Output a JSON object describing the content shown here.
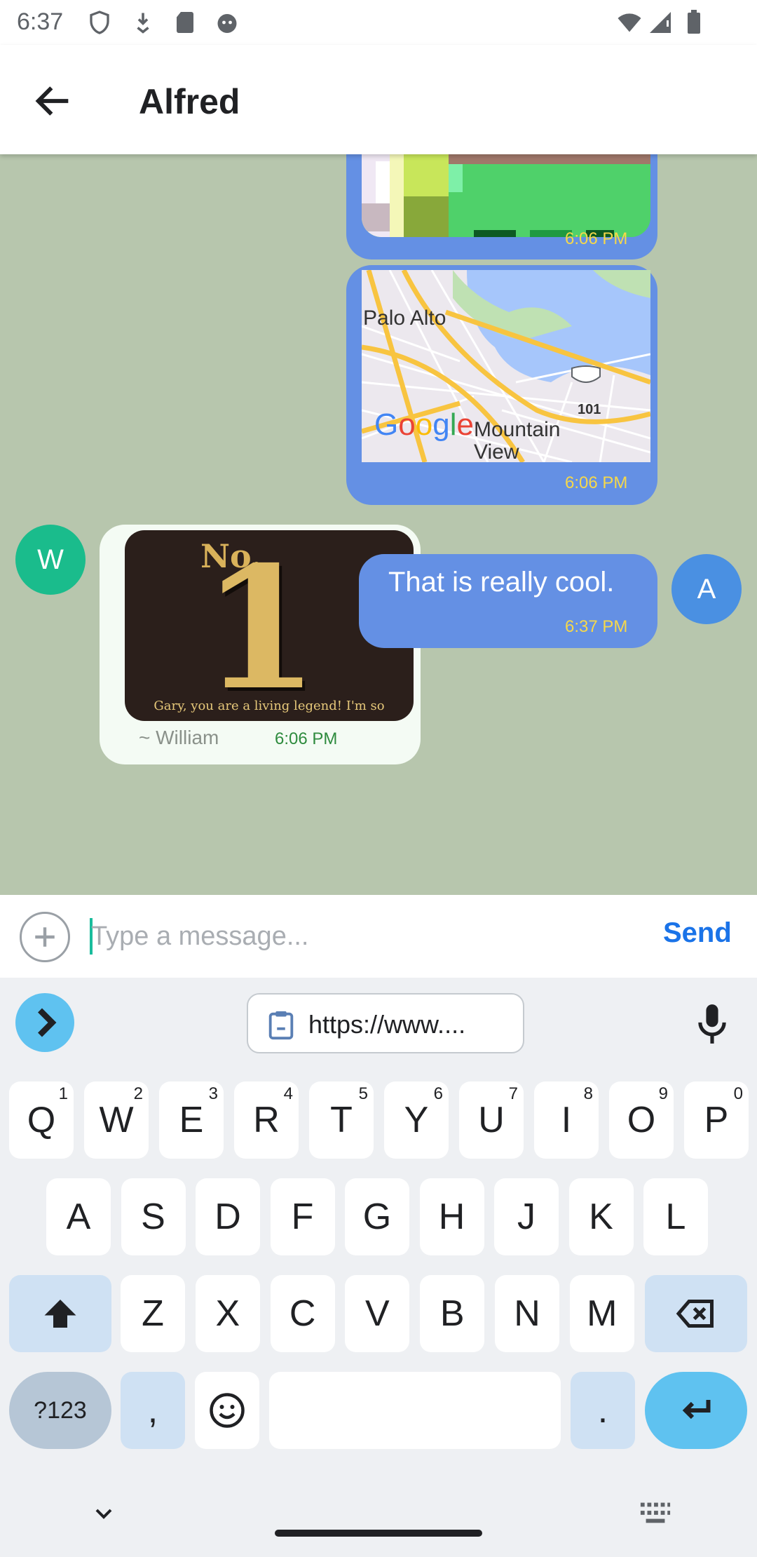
{
  "status_bar": {
    "time": "6:37",
    "icons": [
      "shield-icon",
      "download-icon",
      "sd-card-icon",
      "cat-icon",
      "wifi-icon",
      "signal-icon",
      "battery-icon"
    ]
  },
  "app_bar": {
    "title": "Alfred",
    "back_icon": "arrow-left-icon"
  },
  "messages": [
    {
      "type": "image",
      "direction": "outgoing",
      "time": "6:06 PM"
    },
    {
      "type": "map",
      "direction": "outgoing",
      "time": "6:06 PM",
      "labels": [
        "Palo Alto",
        "Mountain View",
        "101"
      ],
      "logo": "Google"
    },
    {
      "type": "image-card",
      "direction": "incoming",
      "sender_initial": "W",
      "sender": "~ William",
      "time": "6:06 PM",
      "card": {
        "heading": "No.",
        "number": "1",
        "caption": "Gary, you are a living legend! I'm so"
      }
    },
    {
      "type": "text",
      "direction": "outgoing",
      "avatar_initial": "A",
      "text": "That is really cool.",
      "time": "6:37 PM"
    }
  ],
  "composer": {
    "placeholder": "Type a message...",
    "value": "",
    "send_label": "Send"
  },
  "keyboard": {
    "clipboard_chip": "https://www....",
    "row1": [
      {
        "k": "Q",
        "h": "1"
      },
      {
        "k": "W",
        "h": "2"
      },
      {
        "k": "E",
        "h": "3"
      },
      {
        "k": "R",
        "h": "4"
      },
      {
        "k": "T",
        "h": "5"
      },
      {
        "k": "Y",
        "h": "6"
      },
      {
        "k": "U",
        "h": "7"
      },
      {
        "k": "I",
        "h": "8"
      },
      {
        "k": "O",
        "h": "9"
      },
      {
        "k": "P",
        "h": "0"
      }
    ],
    "row2": [
      "A",
      "S",
      "D",
      "F",
      "G",
      "H",
      "J",
      "K",
      "L"
    ],
    "row3": [
      "Z",
      "X",
      "C",
      "V",
      "B",
      "N",
      "M"
    ],
    "sym_label": "?123",
    "comma": ",",
    "period": "."
  },
  "colors": {
    "chat_bg": "#b7c6ad",
    "outgoing_bubble": "#6490e4",
    "incoming_bubble": "#f4fbf4",
    "time_outgoing": "#f6d84a",
    "avatar_w": "#1abc8c",
    "avatar_a": "#4a90e2",
    "send": "#1a73e8"
  }
}
